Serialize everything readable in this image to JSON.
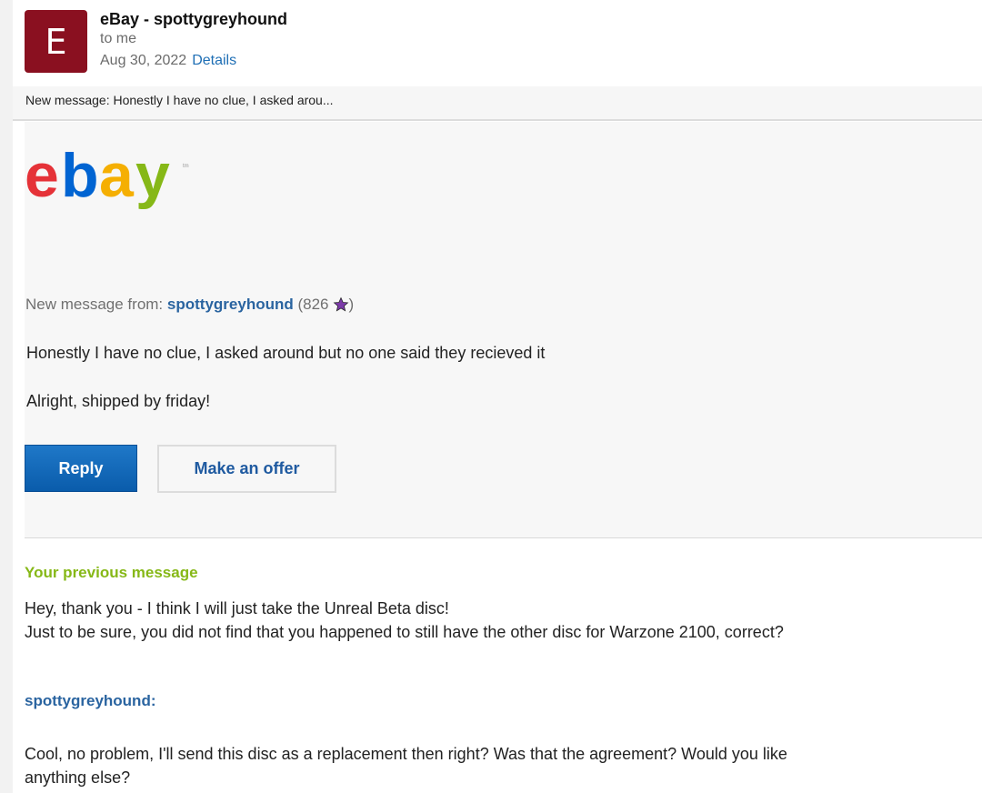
{
  "header": {
    "avatar_letter": "E",
    "sender": "eBay - spottygreyhound",
    "to": "to me",
    "date": "Aug 30, 2022",
    "details_label": "Details"
  },
  "preview": {
    "text": "New message: Honestly I have no clue, I asked arou..."
  },
  "logo": {
    "letters": [
      "e",
      "b",
      "a",
      "y"
    ],
    "tm": "tm",
    "colors": [
      "#e53238",
      "#0064d2",
      "#f5af02",
      "#86b817"
    ]
  },
  "message": {
    "from_prefix": "New message from:",
    "from_user": "spottygreyhound",
    "score_open": "(826",
    "score_close": ")",
    "star_icon": "purple-star-icon",
    "line1": "Honestly I have no clue, I asked around but no one said they recieved it",
    "line2": "Alright, shipped by friday!"
  },
  "buttons": {
    "reply": "Reply",
    "offer": "Make an offer"
  },
  "previous": {
    "title": "Your previous message",
    "body": "Hey, thank you - I think I will just take the Unreal Beta disc!\nJust to be sure, you did not find that you happened to still have the other disc for Warzone 2100, correct?",
    "reply_user": "spottygreyhound:",
    "reply_body": "Cool, no problem, I'll send this disc as a replacement then right? Was that the agreement? Would you like anything else?"
  },
  "colors": {
    "avatar_bg": "#8a1020",
    "link_blue": "#2a64a0",
    "green_heading": "#86b817",
    "reply_button": "#0a5cab"
  }
}
